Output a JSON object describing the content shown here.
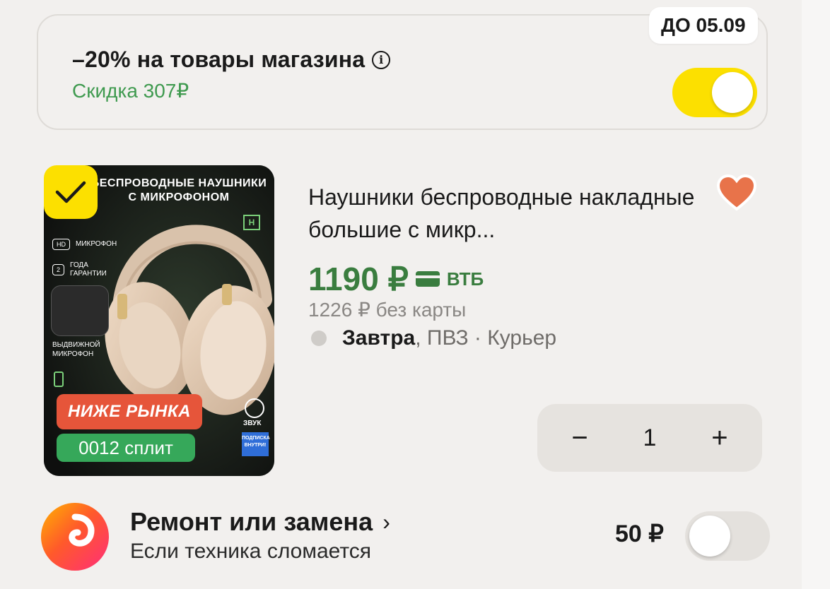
{
  "promo": {
    "title": "–20% на товары магазина",
    "discount": "Скидка 307₽",
    "deadline_badge": "ДО 05.09",
    "toggle_on": true
  },
  "product": {
    "title": "Наушники беспроводные накладные большие с микр...",
    "price": "1190 ₽",
    "bank": "ВТБ",
    "price_without_card": "1226 ₽ без карты",
    "delivery_day": "Завтра",
    "delivery_options": ", ПВЗ · Курьер",
    "selected": true,
    "favorite": true,
    "image": {
      "headline": "БЕСПРОВОДНЫЕ НАУШНИКИ С МИКРОФОНОМ",
      "feature_hd_badge": "HD",
      "feature_hd": "МИКРОФОН",
      "feature_warranty_badge": "2",
      "feature_warranty": "ГОДА ГАРАНТИИ",
      "feature_mic": "ВЫДВИЖНОЙ МИКРОФОН",
      "label_market": "НИЖЕ РЫНКА",
      "label_split": "0012 сплит",
      "sound": "ЗВУК",
      "subscription": "ПОДПИСКА ВНУТРИ!"
    }
  },
  "stepper": {
    "minus": "−",
    "quantity": "1",
    "plus": "+"
  },
  "repair": {
    "title": "Ремонт или замена",
    "subtitle": "Если техника сломается",
    "price": "50 ₽",
    "toggle_on": false
  }
}
